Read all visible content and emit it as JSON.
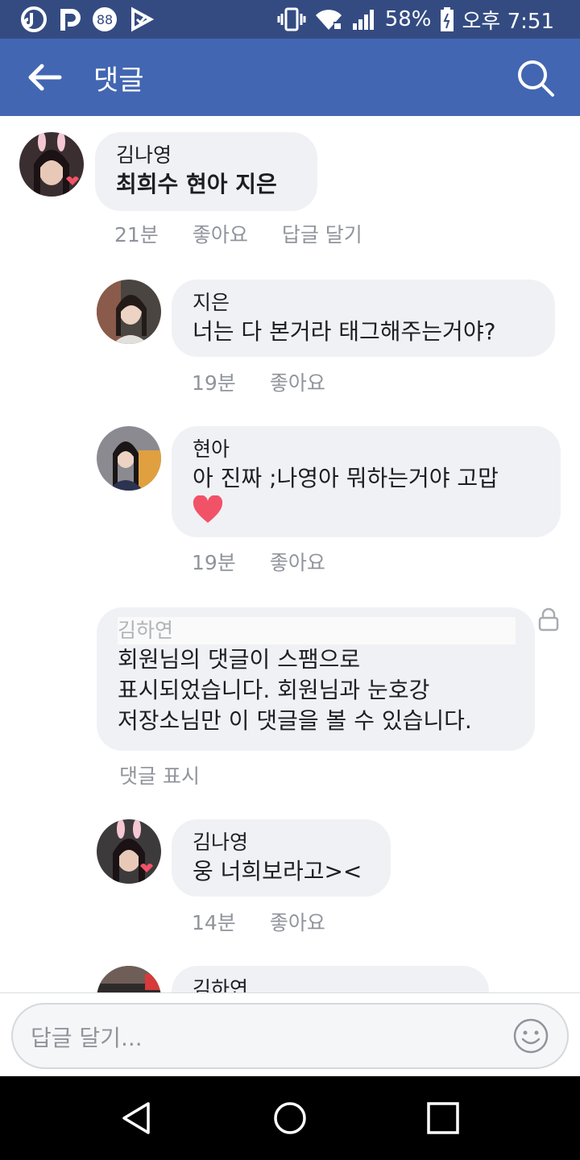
{
  "status_bar": {
    "battery": "58%",
    "time": "오후 7:51"
  },
  "header": {
    "title": "댓글"
  },
  "comments": [
    {
      "name": "김나영",
      "text": "최희수 현아 지은",
      "time": "21분",
      "like": "좋아요",
      "reply": "답글 달기"
    },
    {
      "name": "지은",
      "text": "너는 다 본거라 태그해주는거야?",
      "time": "19분",
      "like": "좋아요"
    },
    {
      "name": "현아",
      "text": "아 진짜 ;나영아 뭐하는거야 고맙",
      "time": "19분",
      "like": "좋아요"
    },
    {
      "name": "김하연",
      "text_line1": "회원님의 댓글이 스팸으로",
      "text_line2": "표시되었습니다. 회원님과 눈호강",
      "text_line3": "저장소님만 이 댓글을 볼 수 있습니다.",
      "show": "댓글 표시"
    },
    {
      "name": "김나영",
      "text": "웅 너희보라고><",
      "time": "14분",
      "like": "좋아요"
    },
    {
      "name": "김하연"
    }
  ],
  "input": {
    "placeholder": "답글 달기..."
  },
  "colors": {
    "status_bar": "#344b82",
    "app_bar": "#4266b2",
    "bubble": "#f0f1f5",
    "heart": "#f25268"
  }
}
